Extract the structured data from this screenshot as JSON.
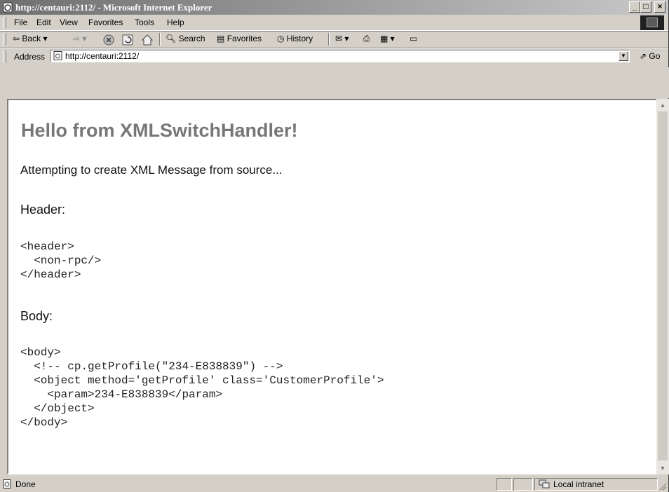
{
  "window": {
    "title": "http://centauri:2112/ - Microsoft Internet Explorer",
    "controls": {
      "minimize": "_",
      "maximize": "□",
      "close": "×"
    }
  },
  "menu": [
    "File",
    "Edit",
    "View",
    "Favorites",
    "Tools",
    "Help"
  ],
  "toolbar": {
    "back": "Back",
    "forward_icon": "forward-arrow",
    "search": "Search",
    "favorites": "Favorites",
    "history": "History"
  },
  "address": {
    "label": "Address",
    "value": "http://centauri:2112/",
    "go": "Go"
  },
  "page": {
    "heading": "Hello from XMLSwitchHandler!",
    "status_line": "Attempting to create XML Message from source...",
    "header_label": "Header:",
    "header_xml": "<header>\n  <non-rpc/>\n</header>",
    "body_label": "Body:",
    "body_xml": "<body>\n  <!-- cp.getProfile(\"234-E838839\") -->\n  <object method='getProfile' class='CustomerProfile'>\n    <param>234-E838839</param>\n  </object>\n</body>"
  },
  "status": {
    "text": "Done",
    "zone": "Local intranet"
  }
}
